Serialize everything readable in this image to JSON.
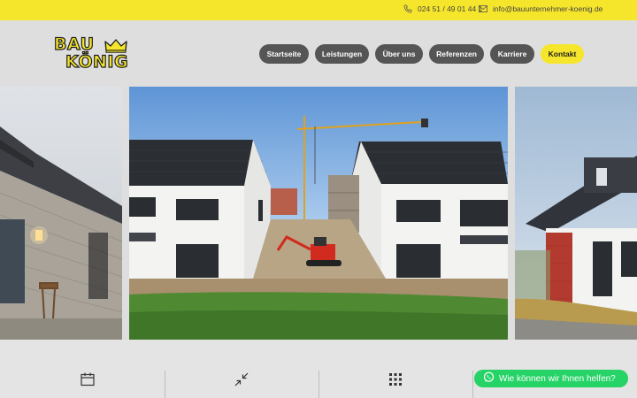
{
  "topbar": {
    "phone_icon": "phone-icon",
    "phone": "024 51 / 49 01 44 1",
    "mail_icon": "mail-icon",
    "email": "info@bauunternehmer-koenig.de"
  },
  "logo": {
    "line1": "BAU",
    "line2": "KÖNIG",
    "emblem": "crown-icon"
  },
  "nav": {
    "items": [
      {
        "label": "Startseite"
      },
      {
        "label": "Leistungen"
      },
      {
        "label": "Über uns"
      },
      {
        "label": "Referenzen"
      },
      {
        "label": "Karriere"
      },
      {
        "label": "Kontakt",
        "active": true
      }
    ]
  },
  "gallery": {
    "slides": [
      {
        "subject": "stone house facade at dusk"
      },
      {
        "subject": "two white houses with solar roofs under construction"
      },
      {
        "subject": "red brick house with solar roof"
      }
    ]
  },
  "features": [
    {
      "icon": "calendar-icon",
      "label": ""
    },
    {
      "icon": "arrows-in-icon",
      "label": ""
    },
    {
      "icon": "grid-dots-icon",
      "label": ""
    }
  ],
  "whatsapp": {
    "icon": "whatsapp-icon",
    "label": "Wie können wir Ihnen helfen?"
  },
  "colors": {
    "brand_yellow": "#f6e62b",
    "nav_gray": "#555555",
    "whatsapp_green": "#25d366"
  }
}
